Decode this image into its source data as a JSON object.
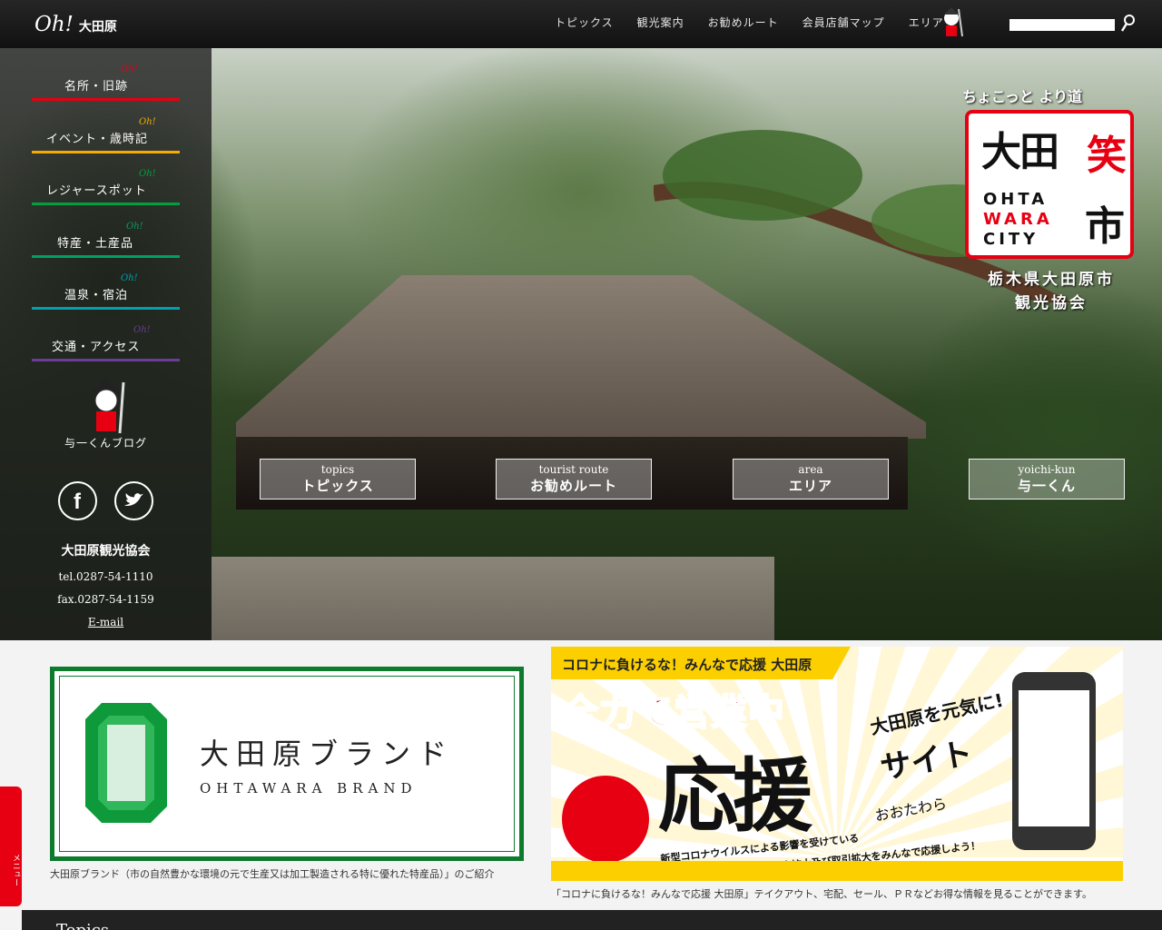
{
  "header": {
    "logo_oh": "Oh!",
    "logo_city": "大田原",
    "nav": [
      "トピックス",
      "観光案内",
      "お勧めルート",
      "会員店舗マップ",
      "エリア"
    ]
  },
  "sidebar": {
    "items": [
      {
        "label": "名所・旧跡",
        "color": "#e60012"
      },
      {
        "label": "イベント・歳時記",
        "color": "#f6ab00"
      },
      {
        "label": "レジャースポット",
        "color": "#00a040"
      },
      {
        "label": "特産・土産品",
        "color": "#00a060"
      },
      {
        "label": "温泉・宿泊",
        "color": "#00a0b0"
      },
      {
        "label": "交通・アクセス",
        "color": "#6a3d9a"
      }
    ],
    "oh_mark": "Oh!",
    "blog": "与一くんブログ",
    "org": "大田原観光協会",
    "tel": "tel.0287-54-1110",
    "fax": "fax.0287-54-1159",
    "email": "E-mail"
  },
  "brand": {
    "sub": "ちょこっと より道",
    "big": "大田",
    "wara": "笑",
    "ichi": "市",
    "en1": "OHTA",
    "en2": "WARA",
    "en3": "CITY",
    "caption1": "栃木県大田原市",
    "caption2": "観光協会"
  },
  "hero_buttons": [
    {
      "en": "topics",
      "ja": "トピックス"
    },
    {
      "en": "tourist route",
      "ja": "お勧めルート"
    },
    {
      "en": "area",
      "ja": "エリア"
    },
    {
      "en": "yoichi-kun",
      "ja": "与一くん"
    }
  ],
  "banner_left": {
    "ja": "大田原ブランド",
    "en": "OHTAWARA BRAND",
    "caption": "大田原ブランド（市の自然豊かな環境の元で生産又は加工製造される特に優れた特産品）」のご紹介"
  },
  "banner_right": {
    "top": "コロナに負けるな！みんなで応援 大田原",
    "main": "全力で営業中",
    "genki": "大田原を元気に!",
    "ouen": "応援",
    "site": "サイト",
    "ohta": "おおたわら",
    "desc1": "新型コロナウイルスによる影響を受けている",
    "desc2": "飲食店や商店、事業所などの販売拡大及び取引拡大をみんなで応援しよう！",
    "caption": "「コロナに負けるな！みんなで応援 大田原」テイクアウト、宅配、セール、ＰＲなどお得な情報を見ることができます。"
  },
  "footer": {
    "title": "Topics"
  },
  "menu_tab": "メニュー"
}
